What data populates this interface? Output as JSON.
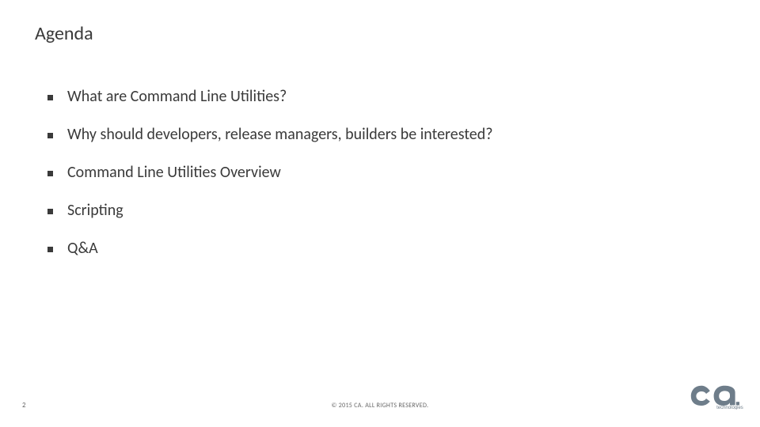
{
  "title": "Agenda",
  "bullets": [
    "What are Command Line Utilities?",
    "Why should developers, release managers, builders be interested?",
    "Command Line Utilities Overview",
    "Scripting",
    "Q&A"
  ],
  "footer": {
    "page": "2",
    "copyright": "© 2015 CA. ALL RIGHTS RESERVED."
  },
  "brand": {
    "name": "ca",
    "tagline": "technologies",
    "color": "#708090"
  }
}
